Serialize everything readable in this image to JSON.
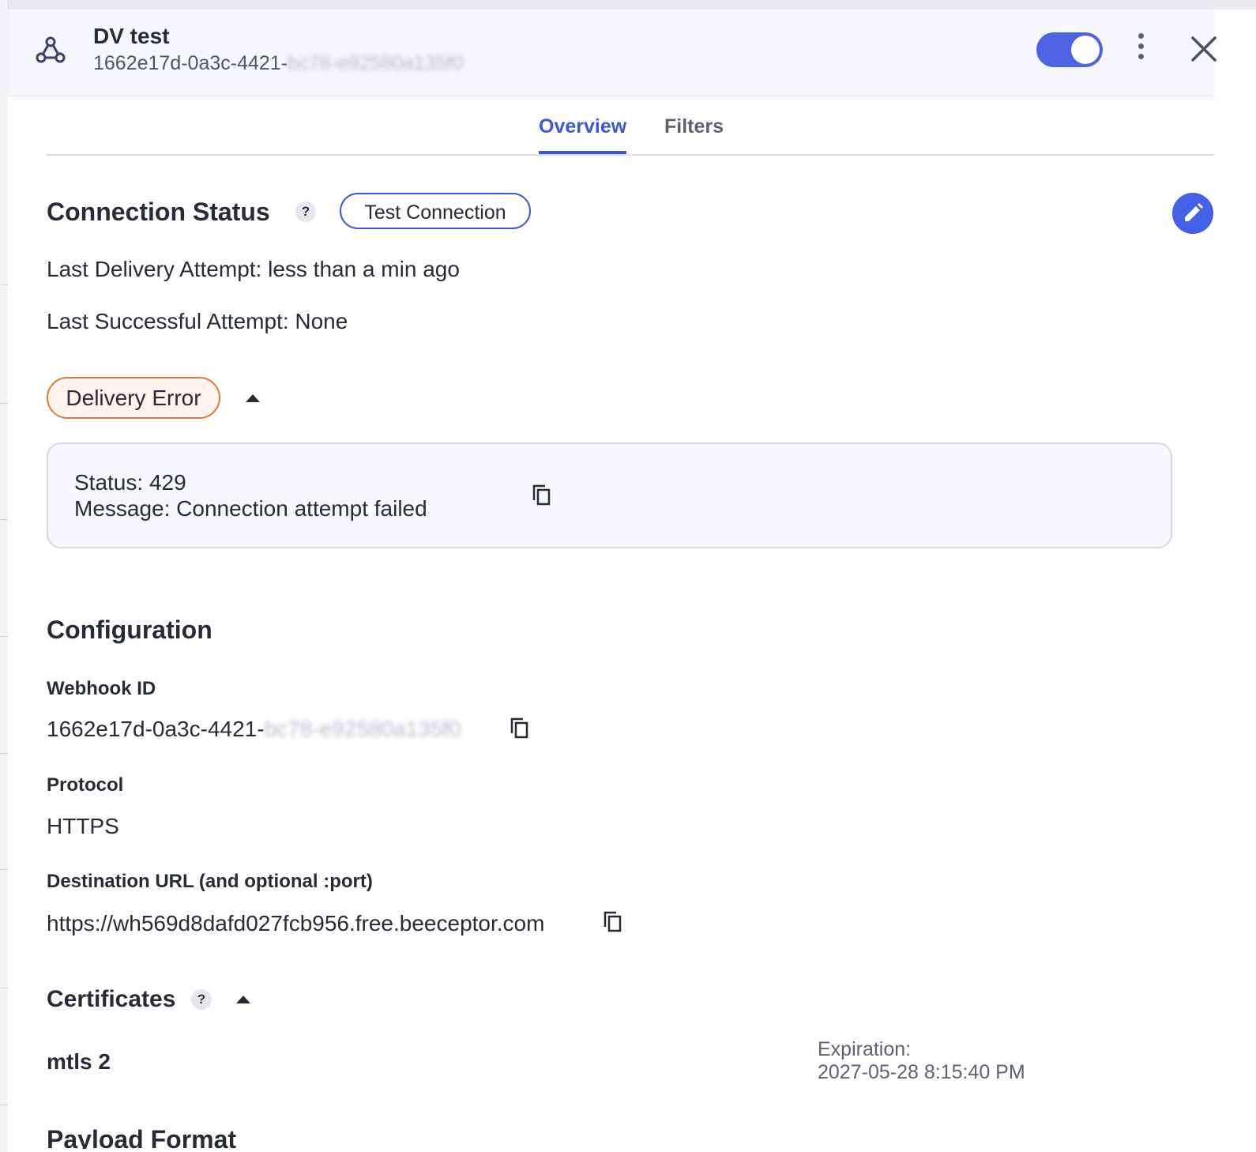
{
  "header": {
    "title": "DV test",
    "id_visible": "1662e17d-0a3c-4421-",
    "id_blurred": "bc78-e92580a135f0",
    "enabled": true
  },
  "tabs": [
    {
      "label": "Overview",
      "active": true
    },
    {
      "label": "Filters",
      "active": false
    }
  ],
  "connection": {
    "heading": "Connection Status",
    "help": "?",
    "test_button": "Test Connection",
    "last_delivery": "Last Delivery Attempt: less than a min ago",
    "last_success": "Last Successful Attempt: None",
    "status_badge": "Delivery Error",
    "error_status": "Status: 429",
    "error_message": "Message: Connection attempt failed"
  },
  "configuration": {
    "heading": "Configuration",
    "webhook_id_label": "Webhook ID",
    "webhook_id_visible": "1662e17d-0a3c-4421-",
    "webhook_id_blurred": "bc78-e92580a135f0",
    "protocol_label": "Protocol",
    "protocol_value": "HTTPS",
    "url_label": "Destination URL (and optional :port)",
    "url_value": "https://wh569d8dafd027fcb956.free.beeceptor.com"
  },
  "certificates": {
    "heading": "Certificates",
    "help": "?",
    "name": "mtls 2",
    "expiration_label": "Expiration:",
    "expiration_value": "2027-05-28 8:15:40 PM"
  },
  "payload_format": {
    "heading": "Payload Format"
  },
  "colors": {
    "accent": "#3f56d8",
    "error_border": "#e07a3a"
  }
}
